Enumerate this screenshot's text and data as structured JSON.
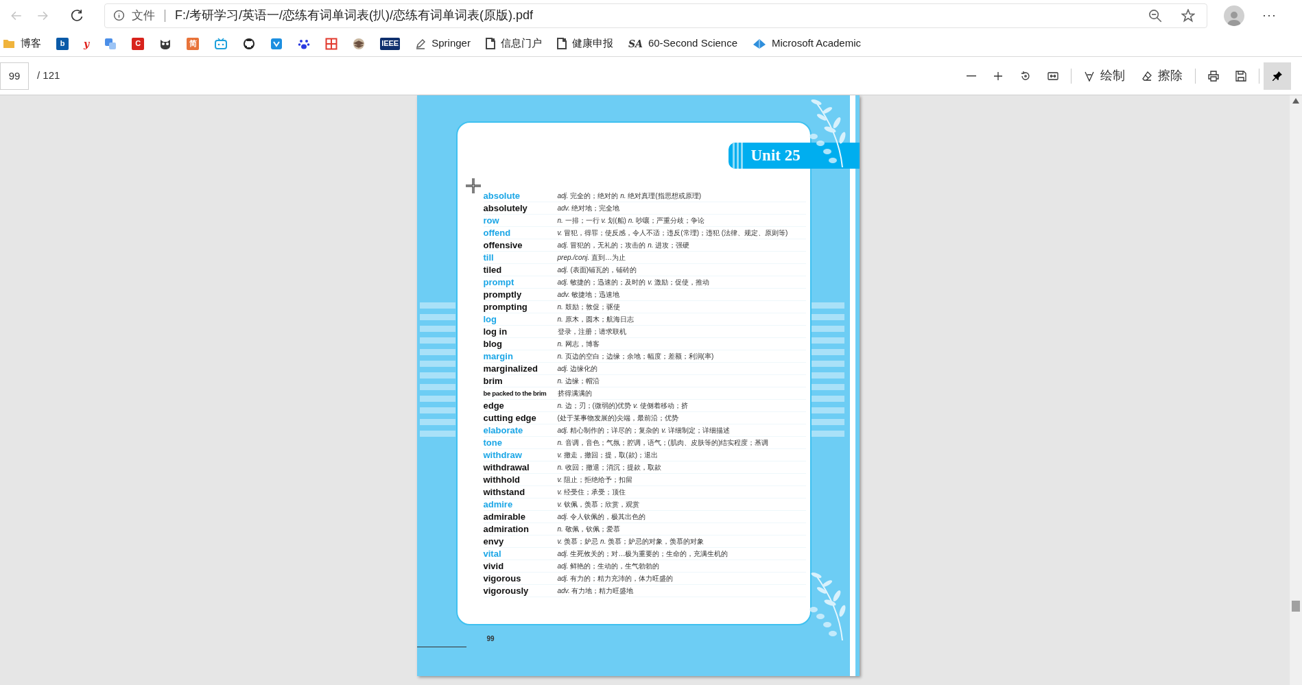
{
  "browser": {
    "back_disabled": true,
    "forward_disabled": true,
    "address": {
      "scheme": "文件",
      "url": "F:/考研学习/英语一/恋练有词单词表(扒)/恋练有词单词表(原版).pdf"
    },
    "menu": "···"
  },
  "bookmarks": [
    {
      "kind": "folder",
      "label": "博客",
      "color": "#f0b43c"
    },
    {
      "kind": "badge",
      "badge": "b",
      "color": "#0a5aa8"
    },
    {
      "kind": "letter",
      "badge": "y",
      "color": "#e0201b"
    },
    {
      "kind": "translate",
      "color": "#4a8ee8"
    },
    {
      "kind": "badge",
      "badge": "C",
      "color": "#d8231c"
    },
    {
      "kind": "owl",
      "color": "#3a3a3a"
    },
    {
      "kind": "badge",
      "badge": "简",
      "color": "#e8733a"
    },
    {
      "kind": "tv",
      "color": "#1ea1dc"
    },
    {
      "kind": "github",
      "color": "#222222"
    },
    {
      "kind": "shield",
      "color": "#1d8fe0"
    },
    {
      "kind": "paw",
      "color": "#2a3ae0"
    },
    {
      "kind": "grid",
      "color": "#e23a2e"
    },
    {
      "kind": "stack",
      "color": "#6b5040"
    },
    {
      "kind": "badge",
      "badge": "IEEE",
      "color": "#10306e"
    },
    {
      "kind": "pen",
      "label": "Springer",
      "color": "#555555"
    },
    {
      "kind": "page",
      "label": "信息门户",
      "color": "#444444"
    },
    {
      "kind": "page",
      "label": "健康申报",
      "color": "#444444"
    },
    {
      "kind": "letter",
      "badge": "SA",
      "label": "60-Second Science",
      "color": "#333333"
    },
    {
      "kind": "academic",
      "label": "Microsoft Academic",
      "color": "#2f8fdc"
    }
  ],
  "pdf_toolbar": {
    "page": "99",
    "total": "/ 121",
    "tools": [
      {
        "kind": "zoom-out",
        "selected": false
      },
      {
        "kind": "zoom-in",
        "selected": false
      },
      {
        "kind": "rotate",
        "selected": false
      },
      {
        "kind": "fit",
        "selected": false
      },
      {
        "kind": "draw",
        "label": "绘制",
        "selected": false
      },
      {
        "kind": "erase",
        "label": "擦除",
        "selected": false
      },
      {
        "kind": "print",
        "selected": false
      },
      {
        "kind": "save",
        "selected": false
      },
      {
        "kind": "pin",
        "selected": true
      }
    ]
  },
  "pdf_page": {
    "unit": "Unit 25",
    "page_number": "99",
    "entries": [
      {
        "kind": "headword",
        "word": "absolute",
        "definition": "*adj.* 完全的；绝对的 *n.* 绝对真理(指思想或原理)"
      },
      {
        "kind": "related",
        "word": "absolutely",
        "definition": "*adv.* 绝对地；完全地"
      },
      {
        "kind": "headword",
        "word": "row",
        "definition": "*n.* 一排；一行 *v.* 划(船) *n.* 吵嚷；严重分歧；争论"
      },
      {
        "kind": "headword",
        "word": "offend",
        "definition": "*v.* 冒犯，得罪；使反感，令人不适；违反(常理)；违犯 (法律、规定、原则等)"
      },
      {
        "kind": "related",
        "word": "offensive",
        "definition": "*adj.* 冒犯的，无礼的；攻击的 *n.* 进攻；强硬"
      },
      {
        "kind": "headword",
        "word": "till",
        "definition": "*prep./conj.* 直到…为止"
      },
      {
        "kind": "related",
        "word": "tiled",
        "definition": "*adj.* (表面)铺瓦的，铺砖的"
      },
      {
        "kind": "headword",
        "word": "prompt",
        "definition": "*adj.* 敏捷的；迅速的；及时的 *v.* 激励；促使，推动"
      },
      {
        "kind": "related",
        "word": "promptly",
        "definition": "*adv.* 敏捷地；迅速地"
      },
      {
        "kind": "related",
        "word": "prompting",
        "definition": "*n.* 鼓励；敦促；驱使"
      },
      {
        "kind": "headword",
        "word": "log",
        "definition": "*n.* 原木，圆木；航海日志"
      },
      {
        "kind": "related",
        "word": "log in",
        "definition": "登录，注册；请求联机"
      },
      {
        "kind": "related",
        "word": "blog",
        "definition": "*n.* 网志，博客"
      },
      {
        "kind": "headword",
        "word": "margin",
        "definition": "*n.* 页边的空白；边缘；余地；幅度；差额；利润(率)"
      },
      {
        "kind": "related",
        "word": "marginalized",
        "definition": "*adj.* 边缘化的"
      },
      {
        "kind": "related",
        "word": "brim",
        "definition": "*n.* 边缘；帽沿"
      },
      {
        "kind": "phrase",
        "word": "be packed to the brim",
        "definition": "挤得满满的"
      },
      {
        "kind": "related",
        "word": "edge",
        "definition": "*n.* 边；刃；(微弱的)优势 *v.* 使侧着移动；挤"
      },
      {
        "kind": "related",
        "word": "cutting edge",
        "definition": "(处于某事物发展的)尖端，最前沿；优势"
      },
      {
        "kind": "headword",
        "word": "elaborate",
        "definition": "*adj.* 精心制作的；详尽的；复杂的 *v.* 详细制定；详细描述"
      },
      {
        "kind": "headword",
        "word": "tone",
        "definition": "*n.* 音调，音色；气氛；腔调，语气；(肌肉、皮肤等的)结实程度；基调"
      },
      {
        "kind": "headword",
        "word": "withdraw",
        "definition": "*v.* 撤走，撤回；提，取(款)；退出"
      },
      {
        "kind": "related",
        "word": "withdrawal",
        "definition": "*n.* 收回；撤退；消沉；提款，取款"
      },
      {
        "kind": "related",
        "word": "withhold",
        "definition": "*v.* 阻止；拒绝给予；扣留"
      },
      {
        "kind": "related",
        "word": "withstand",
        "definition": "*v.* 经受住；承受；顶住"
      },
      {
        "kind": "headword",
        "word": "admire",
        "definition": "*v.* 钦佩，羡慕；欣赏，观赏"
      },
      {
        "kind": "related",
        "word": "admirable",
        "definition": "*adj.* 令人钦佩的，极其出色的"
      },
      {
        "kind": "related",
        "word": "admiration",
        "definition": "*n.* 敬佩，钦佩；爱慕"
      },
      {
        "kind": "related",
        "word": "envy",
        "definition": "*v.* 羡慕；妒忌 *n.* 羡慕；妒忌的对象，羡慕的对象"
      },
      {
        "kind": "headword",
        "word": "vital",
        "definition": "*adj.* 生死攸关的；对…极为重要的；生命的，充满生机的"
      },
      {
        "kind": "related",
        "word": "vivid",
        "definition": "*adj.* 鲜艳的；生动的，生气勃勃的"
      },
      {
        "kind": "related",
        "word": "vigorous",
        "definition": "*adj.* 有力的；精力充沛的，体力旺盛的"
      },
      {
        "kind": "related",
        "word": "vigorously",
        "definition": "*adv.* 有力地；精力旺盛地"
      }
    ]
  }
}
